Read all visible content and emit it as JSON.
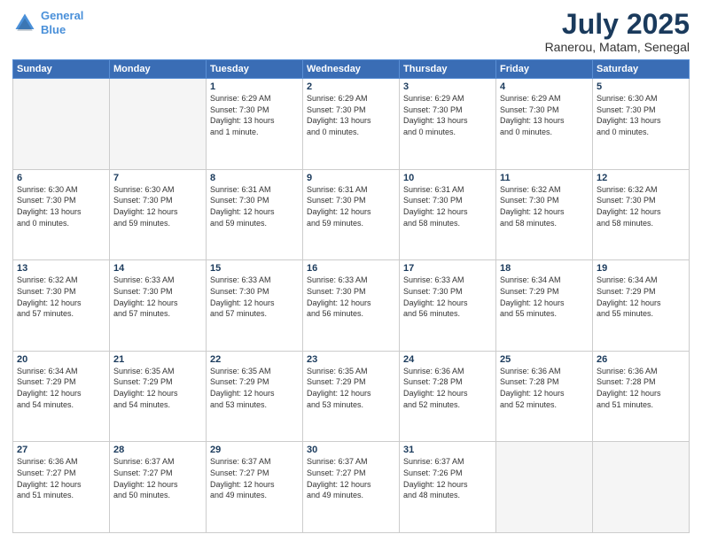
{
  "header": {
    "logo_line1": "General",
    "logo_line2": "Blue",
    "title": "July 2025",
    "subtitle": "Ranerou, Matam, Senegal"
  },
  "days_of_week": [
    "Sunday",
    "Monday",
    "Tuesday",
    "Wednesday",
    "Thursday",
    "Friday",
    "Saturday"
  ],
  "weeks": [
    [
      {
        "day": "",
        "info": ""
      },
      {
        "day": "",
        "info": ""
      },
      {
        "day": "1",
        "info": "Sunrise: 6:29 AM\nSunset: 7:30 PM\nDaylight: 13 hours\nand 1 minute."
      },
      {
        "day": "2",
        "info": "Sunrise: 6:29 AM\nSunset: 7:30 PM\nDaylight: 13 hours\nand 0 minutes."
      },
      {
        "day": "3",
        "info": "Sunrise: 6:29 AM\nSunset: 7:30 PM\nDaylight: 13 hours\nand 0 minutes."
      },
      {
        "day": "4",
        "info": "Sunrise: 6:29 AM\nSunset: 7:30 PM\nDaylight: 13 hours\nand 0 minutes."
      },
      {
        "day": "5",
        "info": "Sunrise: 6:30 AM\nSunset: 7:30 PM\nDaylight: 13 hours\nand 0 minutes."
      }
    ],
    [
      {
        "day": "6",
        "info": "Sunrise: 6:30 AM\nSunset: 7:30 PM\nDaylight: 13 hours\nand 0 minutes."
      },
      {
        "day": "7",
        "info": "Sunrise: 6:30 AM\nSunset: 7:30 PM\nDaylight: 12 hours\nand 59 minutes."
      },
      {
        "day": "8",
        "info": "Sunrise: 6:31 AM\nSunset: 7:30 PM\nDaylight: 12 hours\nand 59 minutes."
      },
      {
        "day": "9",
        "info": "Sunrise: 6:31 AM\nSunset: 7:30 PM\nDaylight: 12 hours\nand 59 minutes."
      },
      {
        "day": "10",
        "info": "Sunrise: 6:31 AM\nSunset: 7:30 PM\nDaylight: 12 hours\nand 58 minutes."
      },
      {
        "day": "11",
        "info": "Sunrise: 6:32 AM\nSunset: 7:30 PM\nDaylight: 12 hours\nand 58 minutes."
      },
      {
        "day": "12",
        "info": "Sunrise: 6:32 AM\nSunset: 7:30 PM\nDaylight: 12 hours\nand 58 minutes."
      }
    ],
    [
      {
        "day": "13",
        "info": "Sunrise: 6:32 AM\nSunset: 7:30 PM\nDaylight: 12 hours\nand 57 minutes."
      },
      {
        "day": "14",
        "info": "Sunrise: 6:33 AM\nSunset: 7:30 PM\nDaylight: 12 hours\nand 57 minutes."
      },
      {
        "day": "15",
        "info": "Sunrise: 6:33 AM\nSunset: 7:30 PM\nDaylight: 12 hours\nand 57 minutes."
      },
      {
        "day": "16",
        "info": "Sunrise: 6:33 AM\nSunset: 7:30 PM\nDaylight: 12 hours\nand 56 minutes."
      },
      {
        "day": "17",
        "info": "Sunrise: 6:33 AM\nSunset: 7:30 PM\nDaylight: 12 hours\nand 56 minutes."
      },
      {
        "day": "18",
        "info": "Sunrise: 6:34 AM\nSunset: 7:29 PM\nDaylight: 12 hours\nand 55 minutes."
      },
      {
        "day": "19",
        "info": "Sunrise: 6:34 AM\nSunset: 7:29 PM\nDaylight: 12 hours\nand 55 minutes."
      }
    ],
    [
      {
        "day": "20",
        "info": "Sunrise: 6:34 AM\nSunset: 7:29 PM\nDaylight: 12 hours\nand 54 minutes."
      },
      {
        "day": "21",
        "info": "Sunrise: 6:35 AM\nSunset: 7:29 PM\nDaylight: 12 hours\nand 54 minutes."
      },
      {
        "day": "22",
        "info": "Sunrise: 6:35 AM\nSunset: 7:29 PM\nDaylight: 12 hours\nand 53 minutes."
      },
      {
        "day": "23",
        "info": "Sunrise: 6:35 AM\nSunset: 7:29 PM\nDaylight: 12 hours\nand 53 minutes."
      },
      {
        "day": "24",
        "info": "Sunrise: 6:36 AM\nSunset: 7:28 PM\nDaylight: 12 hours\nand 52 minutes."
      },
      {
        "day": "25",
        "info": "Sunrise: 6:36 AM\nSunset: 7:28 PM\nDaylight: 12 hours\nand 52 minutes."
      },
      {
        "day": "26",
        "info": "Sunrise: 6:36 AM\nSunset: 7:28 PM\nDaylight: 12 hours\nand 51 minutes."
      }
    ],
    [
      {
        "day": "27",
        "info": "Sunrise: 6:36 AM\nSunset: 7:27 PM\nDaylight: 12 hours\nand 51 minutes."
      },
      {
        "day": "28",
        "info": "Sunrise: 6:37 AM\nSunset: 7:27 PM\nDaylight: 12 hours\nand 50 minutes."
      },
      {
        "day": "29",
        "info": "Sunrise: 6:37 AM\nSunset: 7:27 PM\nDaylight: 12 hours\nand 49 minutes."
      },
      {
        "day": "30",
        "info": "Sunrise: 6:37 AM\nSunset: 7:27 PM\nDaylight: 12 hours\nand 49 minutes."
      },
      {
        "day": "31",
        "info": "Sunrise: 6:37 AM\nSunset: 7:26 PM\nDaylight: 12 hours\nand 48 minutes."
      },
      {
        "day": "",
        "info": ""
      },
      {
        "day": "",
        "info": ""
      }
    ]
  ]
}
